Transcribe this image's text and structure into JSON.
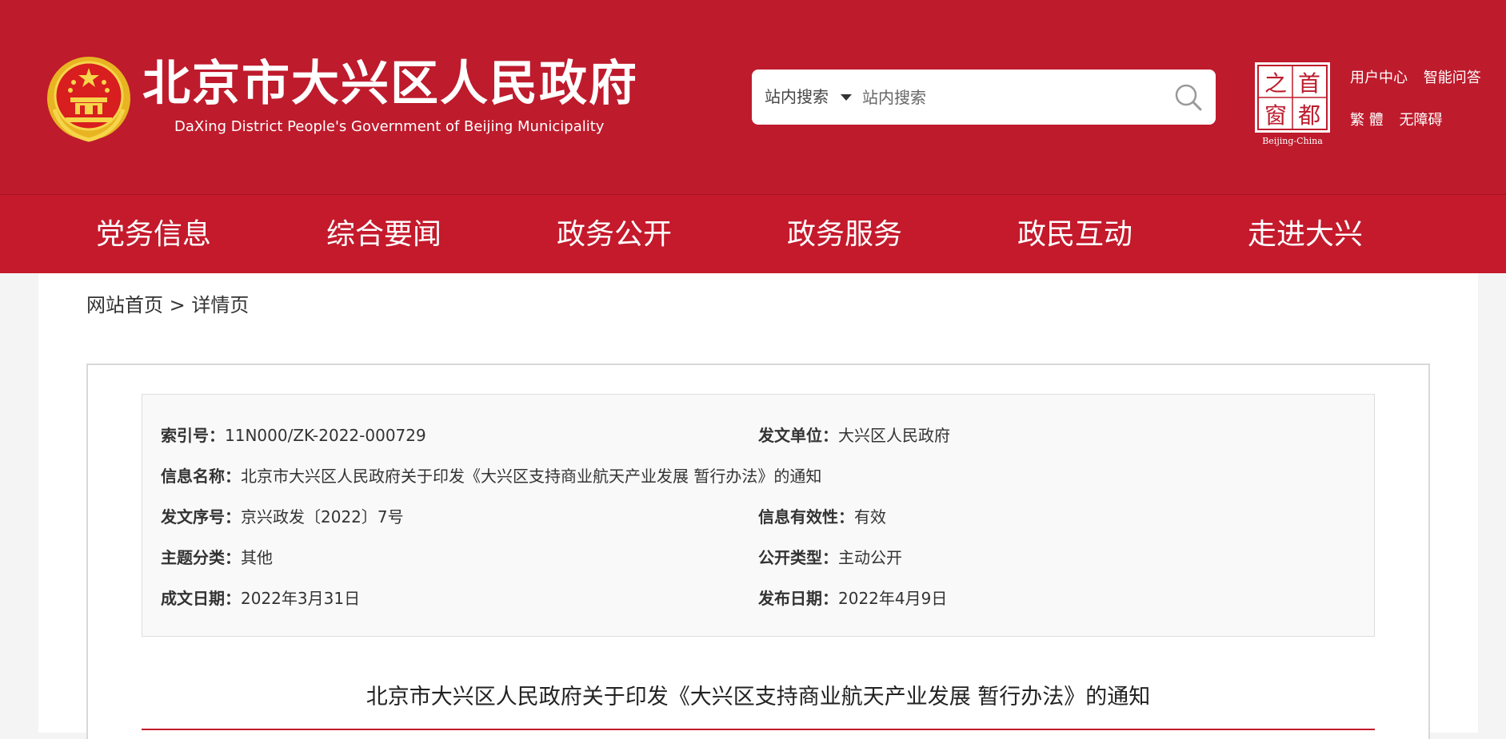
{
  "header": {
    "title": "北京市大兴区人民政府",
    "subtitle": "DaXing District People's Government of Beijing Municipality",
    "search": {
      "scope": "站内搜索",
      "placeholder": "站内搜索"
    },
    "capital_window": {
      "chars": [
        "首",
        "之",
        "都",
        "窗"
      ],
      "caption": "Beijing-China"
    },
    "links_row1": [
      "用户中心",
      "智能问答"
    ],
    "links_row2": [
      "繁 體",
      "无障碍"
    ]
  },
  "nav": {
    "items": [
      "党务信息",
      "综合要闻",
      "政务公开",
      "政务服务",
      "政民互动",
      "走进大兴"
    ]
  },
  "breadcrumb": {
    "home": "网站首页",
    "separator": ">",
    "current": "详情页"
  },
  "meta": {
    "index_no": {
      "label": "索引号：",
      "value": "11N000/ZK-2022-000729"
    },
    "issuer": {
      "label": "发文单位：",
      "value": "大兴区人民政府"
    },
    "info_name": {
      "label": "信息名称：",
      "value": "北京市大兴区人民政府关于印发《大兴区支持商业航天产业发展 暂行办法》的通知"
    },
    "doc_no": {
      "label": "发文序号：",
      "value": "京兴政发〔2022〕7号"
    },
    "validity": {
      "label": "信息有效性：",
      "value": "有效"
    },
    "category": {
      "label": "主题分类：",
      "value": "其他"
    },
    "disclosure": {
      "label": "公开类型：",
      "value": "主动公开"
    },
    "written_date": {
      "label": "成文日期：",
      "value": "2022年3月31日"
    },
    "publish_date": {
      "label": "发布日期：",
      "value": "2022年4月9日"
    }
  },
  "article": {
    "title": "北京市大兴区人民政府关于印发《大兴区支持商业航天产业发展 暂行办法》的通知"
  },
  "colors": {
    "header_red": "#be1b2c",
    "nav_red": "#c41a2c",
    "emblem_gold": "#f2c12e"
  }
}
